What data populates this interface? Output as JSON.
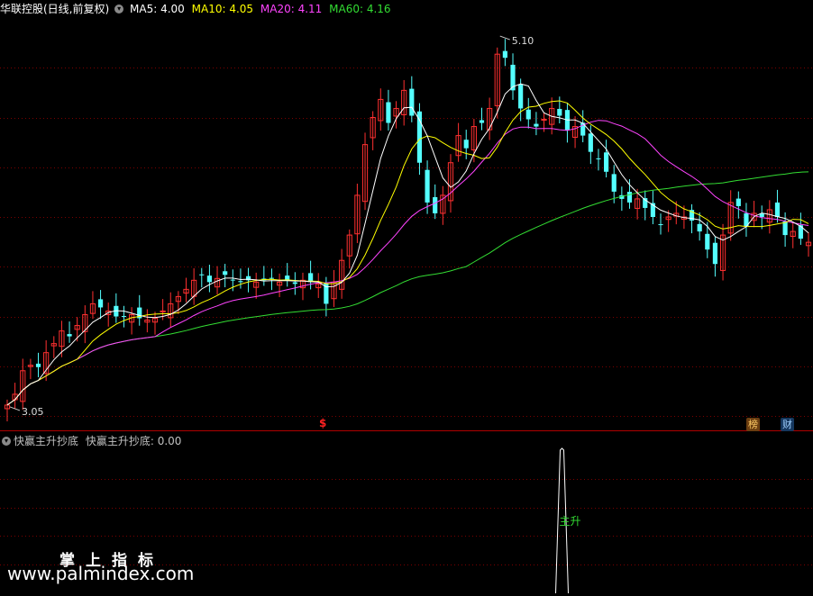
{
  "header": {
    "stock_name": "华联控股(日线,前复权)",
    "ma5": "MA5: 4.00",
    "ma10": "MA10: 4.05",
    "ma20": "MA20: 4.11",
    "ma60": "MA60: 4.16"
  },
  "indicator_header": {
    "name": "快赢主升抄底",
    "value_text": "快赢主升抄底: 0.00"
  },
  "annotations": {
    "high_label": "5.10",
    "low_label": "3.05",
    "signal_label": "主升",
    "s_marker": "$",
    "badge_bang": "榜",
    "badge_cai": "财"
  },
  "watermark": {
    "cn": "掌上指标",
    "url": "www.palmindex.com"
  },
  "colors": {
    "background": "#000000",
    "up_candle": "#ff3030",
    "down_candle": "#54ffff",
    "ma5": "#ffffff",
    "ma10": "#ffff00",
    "ma20": "#ff44ff",
    "ma60": "#33dd33",
    "grid": "#7a0000"
  },
  "chart_data": [
    {
      "type": "candlestick",
      "ylim": [
        3.0,
        5.2
      ],
      "high": 5.1,
      "low": 3.05,
      "moving_averages": {
        "MA5": 4.0,
        "MA10": 4.05,
        "MA20": 4.11,
        "MA60": 4.16
      },
      "closes": [
        3.06,
        3.12,
        3.25,
        3.28,
        3.27,
        3.35,
        3.4,
        3.47,
        3.44,
        3.5,
        3.56,
        3.62,
        3.6,
        3.58,
        3.55,
        3.55,
        3.56,
        3.54,
        3.53,
        3.54,
        3.58,
        3.62,
        3.66,
        3.7,
        3.75,
        3.78,
        3.74,
        3.76,
        3.78,
        3.75,
        3.74,
        3.75,
        3.74,
        3.75,
        3.76,
        3.74,
        3.75,
        3.73,
        3.75,
        3.74,
        3.73,
        3.62,
        3.74,
        3.86,
        4.0,
        4.22,
        4.5,
        4.65,
        4.75,
        4.62,
        4.7,
        4.8,
        4.66,
        4.4,
        4.18,
        4.12,
        4.22,
        4.4,
        4.55,
        4.48,
        4.6,
        4.62,
        4.7,
        5.0,
        4.98,
        4.8,
        4.7,
        4.64,
        4.6,
        4.64,
        4.7,
        4.66,
        4.58,
        4.6,
        4.55,
        4.46,
        4.42,
        4.35,
        4.24,
        4.2,
        4.18,
        4.2,
        4.15,
        4.1,
        4.06,
        4.1,
        4.12,
        4.1,
        4.08,
        4.02,
        3.92,
        3.84,
        4.0,
        4.18,
        4.16,
        4.05,
        4.12,
        4.1,
        4.14,
        4.1,
        4.0,
        4.02,
        3.98,
        3.96
      ]
    },
    {
      "type": "line",
      "series": [
        {
          "values": [
            0,
            0,
            0,
            0,
            0,
            0,
            0,
            0,
            0,
            0,
            0,
            0,
            0,
            0,
            0,
            0,
            0,
            0,
            0,
            0,
            0,
            0,
            0,
            0,
            0,
            0,
            0,
            0,
            0,
            0,
            0,
            0,
            0,
            0,
            0,
            0,
            0,
            0,
            0,
            0,
            0,
            0,
            0,
            0,
            0,
            0,
            0,
            0,
            0,
            0,
            0,
            0,
            0,
            0,
            0,
            0,
            0,
            0,
            0,
            0,
            0,
            0,
            0,
            0,
            0,
            0,
            0,
            0,
            0,
            0,
            0,
            0,
            0,
            0,
            0,
            0,
            0,
            0,
            0,
            0,
            0,
            0,
            0,
            0,
            0,
            0,
            0,
            0,
            0,
            0,
            0,
            0,
            0,
            0,
            0,
            0,
            0,
            0,
            0,
            0,
            0,
            0,
            0,
            0,
            0
          ]
        },
        {
          "values": [
            0,
            0,
            0,
            0,
            0,
            0,
            0,
            0,
            0,
            0,
            0,
            0,
            0,
            0,
            0,
            0,
            0,
            0,
            0,
            0,
            0,
            0,
            0,
            0,
            0,
            0,
            0,
            0,
            0,
            0,
            0,
            0,
            0,
            0,
            0,
            0,
            0,
            0,
            0,
            0,
            0,
            0,
            0,
            0,
            0,
            0,
            0,
            0,
            0,
            0,
            0,
            0,
            0,
            0,
            0,
            0,
            0,
            0,
            0,
            0,
            0,
            0,
            0,
            0,
            0,
            0,
            0,
            0,
            0,
            0,
            0,
            0,
            0,
            0,
            0,
            0,
            0,
            0,
            0,
            0,
            0,
            0,
            0,
            0,
            0,
            0,
            0,
            0,
            0,
            0,
            0,
            0,
            0,
            0,
            0,
            0,
            0,
            0,
            0,
            0,
            0,
            0,
            0,
            0,
            0
          ]
        }
      ],
      "signal_index": 72,
      "signal_value": 1.0
    }
  ]
}
